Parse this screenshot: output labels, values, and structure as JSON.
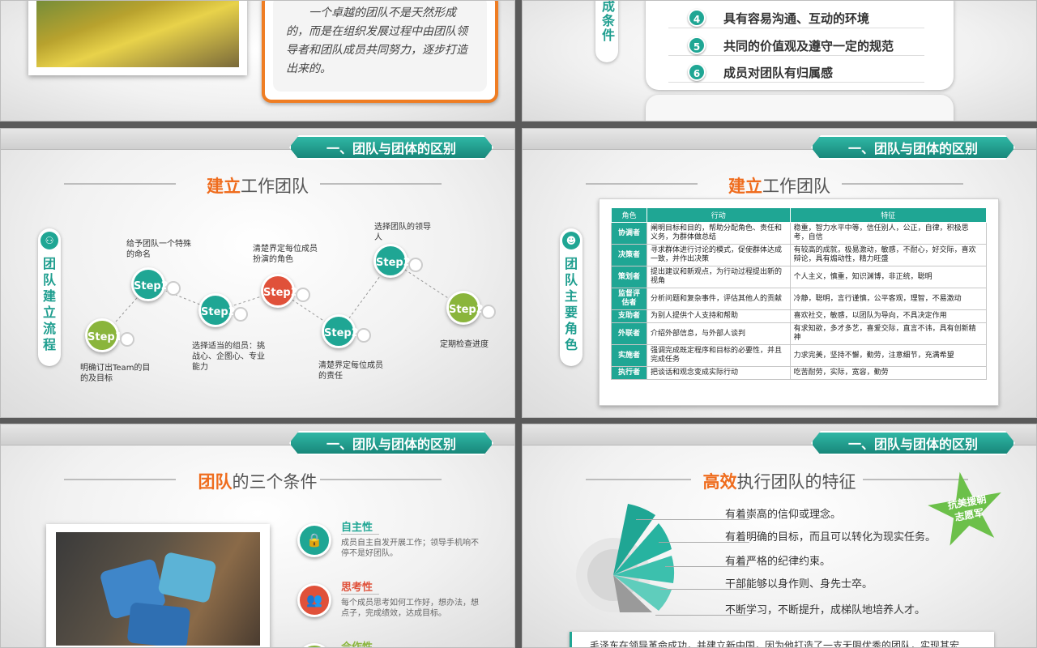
{
  "colors": {
    "teal": "#1fa694",
    "orange": "#ef6c1d",
    "green": "#8ab53c",
    "red": "#e0513a"
  },
  "slide1": {
    "quote": "一个卓越的团队不是天然形成的，而是在组织发展过程中由团队领导者和团队成员共同努力，逐步打造出来的。"
  },
  "slide2": {
    "side_label": "成条件",
    "items": [
      {
        "num": "4",
        "text": "具有容易沟通、互动的环境"
      },
      {
        "num": "5",
        "text": "共同的价值观及遵守一定的规范"
      },
      {
        "num": "6",
        "text": "成员对团队有归属感"
      }
    ]
  },
  "ribbon": "一、团队与团体的区别",
  "slide3": {
    "title_hl": "建立",
    "title_rest": "工作团队",
    "side_label": "团队建立流程",
    "side_icon": "network-icon",
    "steps": [
      {
        "label": "Step1",
        "text": "明确订出Team的目的及目标"
      },
      {
        "label": "Step2",
        "text": "给予团队一个特殊的命名"
      },
      {
        "label": "Step2",
        "text": "选择适当的组员：挑战心、企图心、专业能力"
      },
      {
        "label": "Step2",
        "text": "清楚界定每位成员扮演的角色"
      },
      {
        "label": "Step2",
        "text": "清楚界定每位成员的责任"
      },
      {
        "label": "Step2",
        "text": "选择团队的领导人"
      },
      {
        "label": "Step2",
        "text": "定期检查进度"
      }
    ]
  },
  "slide4": {
    "title_hl": "建立",
    "title_rest": "工作团队",
    "side_label": "团队主要角色",
    "side_icon": "group-icon",
    "headers": [
      "角色",
      "行动",
      "特征"
    ],
    "rows": [
      [
        "协调者",
        "阐明目标和目的，帮助分配角色、责任和义务，为群体做总结",
        "稳重，智力水平中等，信任别人，公正，自律，积极思考，自信"
      ],
      [
        "决策者",
        "寻求群体进行讨论的模式，促使群体达成一致，并作出决策",
        "有较高的成就，极易激动，敏感，不耐心，好交际，喜欢辩论，具有煽动性，精力旺盛"
      ],
      [
        "策划者",
        "提出建议和新观点，为行动过程提出新的视角",
        "个人主义，慎重，知识渊博，非正统，聪明"
      ],
      [
        "监督评估者",
        "分析问题和复杂事件，评估其他人的贡献",
        "冷静，聪明，言行谨慎，公平客观，理智，不易激动"
      ],
      [
        "支助者",
        "为别人提供个人支持和帮助",
        "喜欢社交，敏感，以团队为导向，不具决定作用"
      ],
      [
        "外联者",
        "介绍外部信息，与外部人谈判",
        "有求知欲，多才多艺，喜爱交际，直言不讳，具有创新精神"
      ],
      [
        "实施者",
        "强调完成既定程序和目标的必要性，并且完成任务",
        "力求完美，坚持不懈，勤劳，注意细节，充满希望"
      ],
      [
        "执行者",
        "把谈话和观念变成实际行动",
        "吃苦耐劳，实际，宽容，勤劳"
      ]
    ]
  },
  "slide5": {
    "title_hl": "团队",
    "title_rest": "的三个条件",
    "conds": [
      {
        "title": "自主性",
        "desc": "成员自主自发开展工作；领导手机响不停不是好团队。",
        "icon": "lock-icon"
      },
      {
        "title": "思考性",
        "desc": "每个成员思考如何工作好，想办法，想点子，完成绩效，达成目标。",
        "icon": "people-icon"
      },
      {
        "title": "合作性",
        "desc": "",
        "icon": "handshake-icon"
      }
    ]
  },
  "slide6": {
    "title_hl": "高效",
    "title_rest": "执行团队的特征",
    "badge": "抗美援朝志愿军",
    "features": [
      "有着崇高的信仰或理念。",
      "有着明确的目标，而且可以转化为现实任务。",
      "有着严格的纪律约束。",
      "干部能够以身作则、身先士卒。",
      "不断学习，不断提升，成梯队地培养人才。"
    ],
    "footer": "毛泽东在领导革命成功，并建立新中国，因为他打造了一支无限优秀的团队，实现其宏"
  }
}
